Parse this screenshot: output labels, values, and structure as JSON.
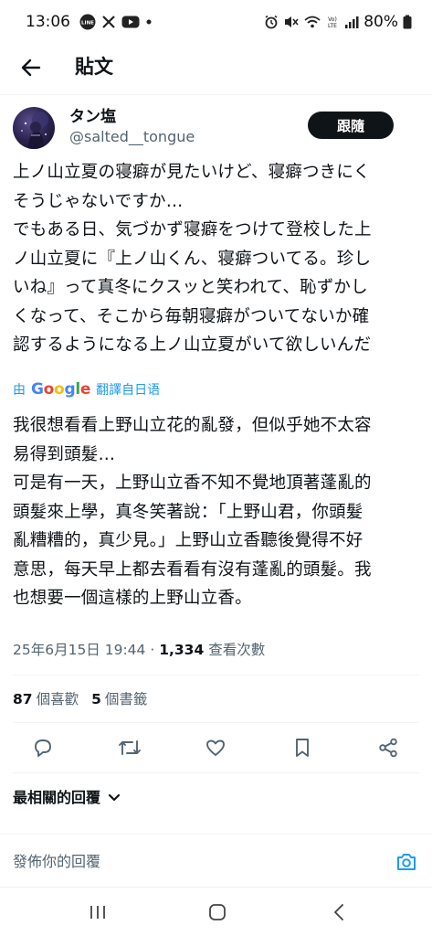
{
  "status_bar": {
    "time": "13:06",
    "line_badge": "LINE",
    "battery": "80%",
    "volte": "Vo)) LTE"
  },
  "header": {
    "title": "貼文"
  },
  "author": {
    "name": "タン塩",
    "handle": "@salted__tongue",
    "follow_label": "跟隨"
  },
  "tweet": {
    "text": "上ノ山立夏の寝癖が見たいけど、寝癖つきにく\nそうじゃないですか…\nでもある日、気づかず寝癖をつけて登校した上\nノ山立夏に『上ノ山くん、寝癖ついてる。珍し\nいね』って真冬にクスッと笑われて、恥ずかし\nくなって、そこから毎朝寝癖がついてないか確\n認するようになる上ノ山立夏がいて欲しいんだ",
    "translate_prefix": "由",
    "translate_brand": "Google",
    "translate_label": "翻譯自日语",
    "translation": "我很想看看上野山立花的亂發，但似乎她不太容\n易得到頭髮…\n可是有一天，上野山立香不知不覺地頂著蓬亂的\n頭髮來上學，真冬笑著說：「上野山君，你頭髮\n亂糟糟的，真少見。」上野山立香聽後覺得不好\n意思，每天早上都去看看有沒有蓬亂的頭髮。我\n也想要一個這樣的上野山立香。",
    "date": "25年6月15日 19:44",
    "separator": "·",
    "views_count": "1,334",
    "views_label": "查看次數"
  },
  "stats": {
    "likes_count": "87",
    "likes_label": "個喜歡",
    "bookmarks_count": "5",
    "bookmarks_label": "個書籤"
  },
  "replies": {
    "sort_label": "最相關的回覆",
    "placeholder": "發佈你的回覆"
  },
  "colors": {
    "accent": "#1d9bf0",
    "text": "#0f1419",
    "secondary": "#536471"
  }
}
